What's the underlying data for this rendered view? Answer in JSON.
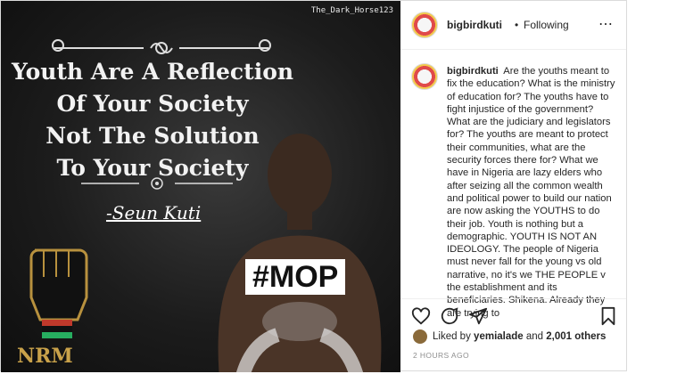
{
  "media": {
    "watermark": "The_Dark_Horse123",
    "quote_lines": [
      "Youth Are A Reflection",
      "Of Your Society",
      "Not The Solution",
      "To Your Society"
    ],
    "signature": "-Seun Kuti",
    "hashtag": "#MOP",
    "logo_text": "NRM"
  },
  "header": {
    "username": "bigbirdkuti",
    "separator": "•",
    "follow_status": "Following",
    "more_icon": "⋯"
  },
  "caption": {
    "username": "bigbirdkuti",
    "text": "Are the youths meant to fix the education? What is the ministry of education for? The youths have to fight injustice of the government? What are the judiciary and legislators for? The youths are meant to protect their communities, what are the security forces there for? What we have in Nigeria are lazy elders who after seizing all the common wealth and political power to build our nation are now asking the YOUTHS to do their job. Youth is nothing but a demographic. YOUTH IS NOT AN IDEOLOGY. The people of Nigeria must never fall for the young vs old narrative, no it's we THE PEOPLE v the establishment and its beneficiaries. Shikena. Already they are trying to"
  },
  "actions": {
    "icons": [
      "heart-icon",
      "comment-icon",
      "share-icon",
      "bookmark-icon"
    ]
  },
  "likes": {
    "prefix": "Liked by",
    "liker": "yemialade",
    "middle": "and",
    "others": "2,001 others"
  },
  "timestamp": "2 HOURS AGO"
}
